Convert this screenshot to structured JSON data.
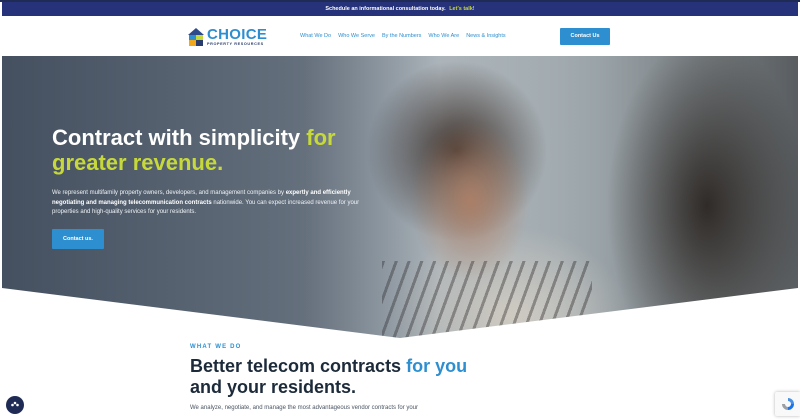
{
  "announcement": {
    "text": "Schedule an informational consultation today.",
    "link": "Let's talk!"
  },
  "logo": {
    "name": "CHOICE",
    "tagline": "PROPERTY RESOURCES"
  },
  "nav": {
    "items": [
      "What We Do",
      "Who We Serve",
      "By the Numbers",
      "Who We Are",
      "News & Insights"
    ],
    "cta": "Contact Us"
  },
  "hero": {
    "title_main": "Contract with simplicity",
    "title_accent": "for greater revenue.",
    "text_lead": "We represent multifamily property owners, developers, and management companies by",
    "text_bold": "expertly and efficiently negotiating and managing telecommunication contracts",
    "text_tail": "nationwide. You can expect increased revenue for your properties and high-quality services for your residents.",
    "button": "Contact us."
  },
  "section": {
    "eyebrow": "WHAT WE DO",
    "title_main": "Better telecom contracts",
    "title_accent": "for you",
    "title_line2": "and your residents.",
    "text": "We analyze, negotiate, and manage the most advantageous vendor contracts for your"
  },
  "colors": {
    "primary_blue": "#2e8fd0",
    "accent_green": "#c7d93a",
    "navy": "#26337a"
  },
  "icons": {
    "accessibility": "accessibility-icon",
    "recaptcha": "recaptcha-icon"
  }
}
